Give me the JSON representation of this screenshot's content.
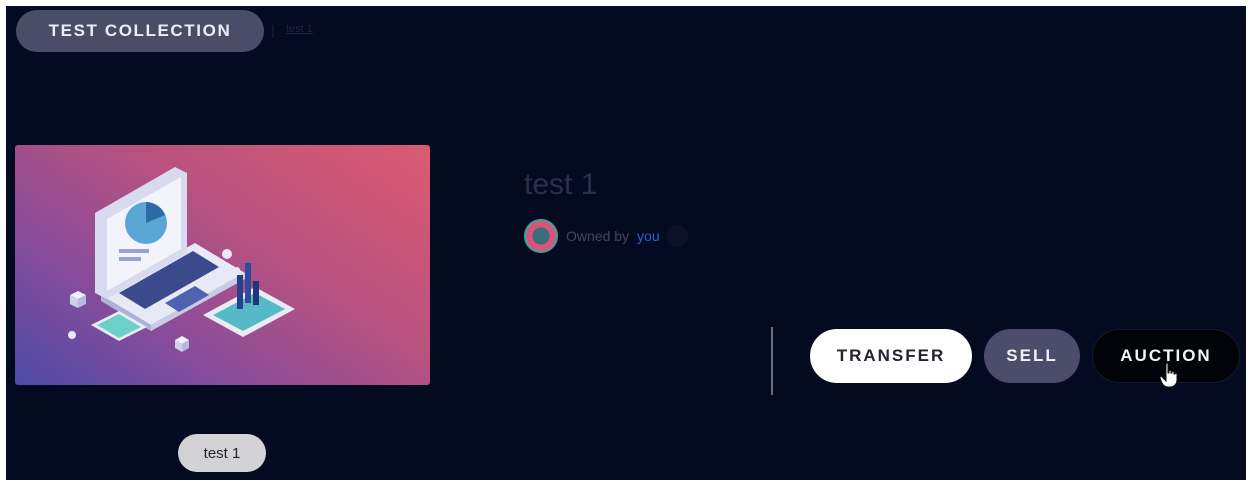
{
  "header": {
    "collection_label": "TEST COLLECTION",
    "breadcrumb_separator": "|",
    "breadcrumb_item": "test 1"
  },
  "artwork": {
    "alt": "test 1",
    "label": "test 1"
  },
  "item": {
    "title": "test 1",
    "owned_by_label": "Owned by",
    "owner": "you"
  },
  "actions": {
    "transfer_label": "TRANSFER",
    "sell_label": "SELL",
    "auction_label": "AUCTION"
  },
  "colors": {
    "background": "#040a20",
    "pill": "#4a4d68",
    "owner_link": "#2f5fd8"
  }
}
